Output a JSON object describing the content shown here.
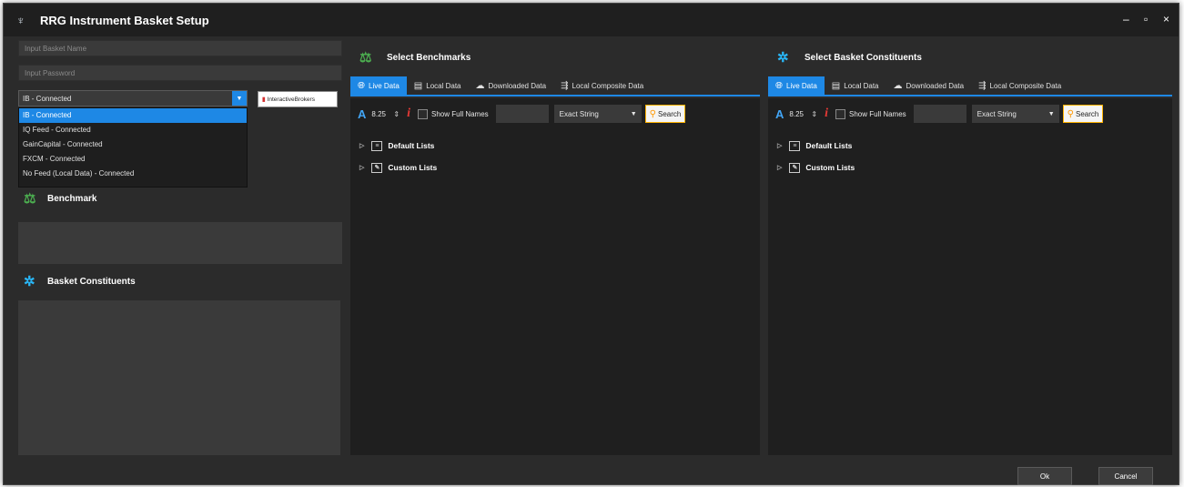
{
  "window": {
    "title": "RRG Instrument Basket Setup",
    "controls": {
      "minimize": "–",
      "maximize": "▫",
      "close": "×"
    }
  },
  "left": {
    "basket_name_placeholder": "Input Basket Name",
    "password_placeholder": "Input Password",
    "feed_selected": "IB - Connected",
    "feed_options": [
      "IB - Connected",
      "IQ Feed - Connected",
      "GainCapital - Connected",
      "FXCM - Connected",
      "No Feed (Local Data) - Connected"
    ],
    "logo_text": "InteractiveBrokers",
    "benchmark_label": "Benchmark",
    "constituents_label": "Basket Constituents"
  },
  "benchmarks_panel": {
    "title": "Select Benchmarks",
    "tabs": [
      {
        "label": "Live Data",
        "icon": "globe-icon"
      },
      {
        "label": "Local Data",
        "icon": "local-data-icon"
      },
      {
        "label": "Downloaded Data",
        "icon": "cloud-download-icon"
      },
      {
        "label": "Local Composite Data",
        "icon": "composite-icon"
      }
    ],
    "font_size": "8.25",
    "show_full_names": "Show Full Names",
    "match_mode": "Exact String",
    "search_label": "Search",
    "tree": [
      "Default Lists",
      "Custom Lists"
    ]
  },
  "constituents_panel": {
    "title": "Select Basket Constituents",
    "tabs": [
      {
        "label": "Live Data",
        "icon": "globe-icon"
      },
      {
        "label": "Local Data",
        "icon": "local-data-icon"
      },
      {
        "label": "Downloaded Data",
        "icon": "cloud-download-icon"
      },
      {
        "label": "Local Composite Data",
        "icon": "composite-icon"
      }
    ],
    "font_size": "8.25",
    "show_full_names": "Show Full Names",
    "match_mode": "Exact String",
    "search_label": "Search",
    "tree": [
      "Default Lists",
      "Custom Lists"
    ]
  },
  "footer": {
    "ok": "Ok",
    "cancel": "Cancel"
  },
  "colors": {
    "accent": "#1e88e5",
    "background": "#2b2b2b",
    "field": "#3a3a3a"
  }
}
